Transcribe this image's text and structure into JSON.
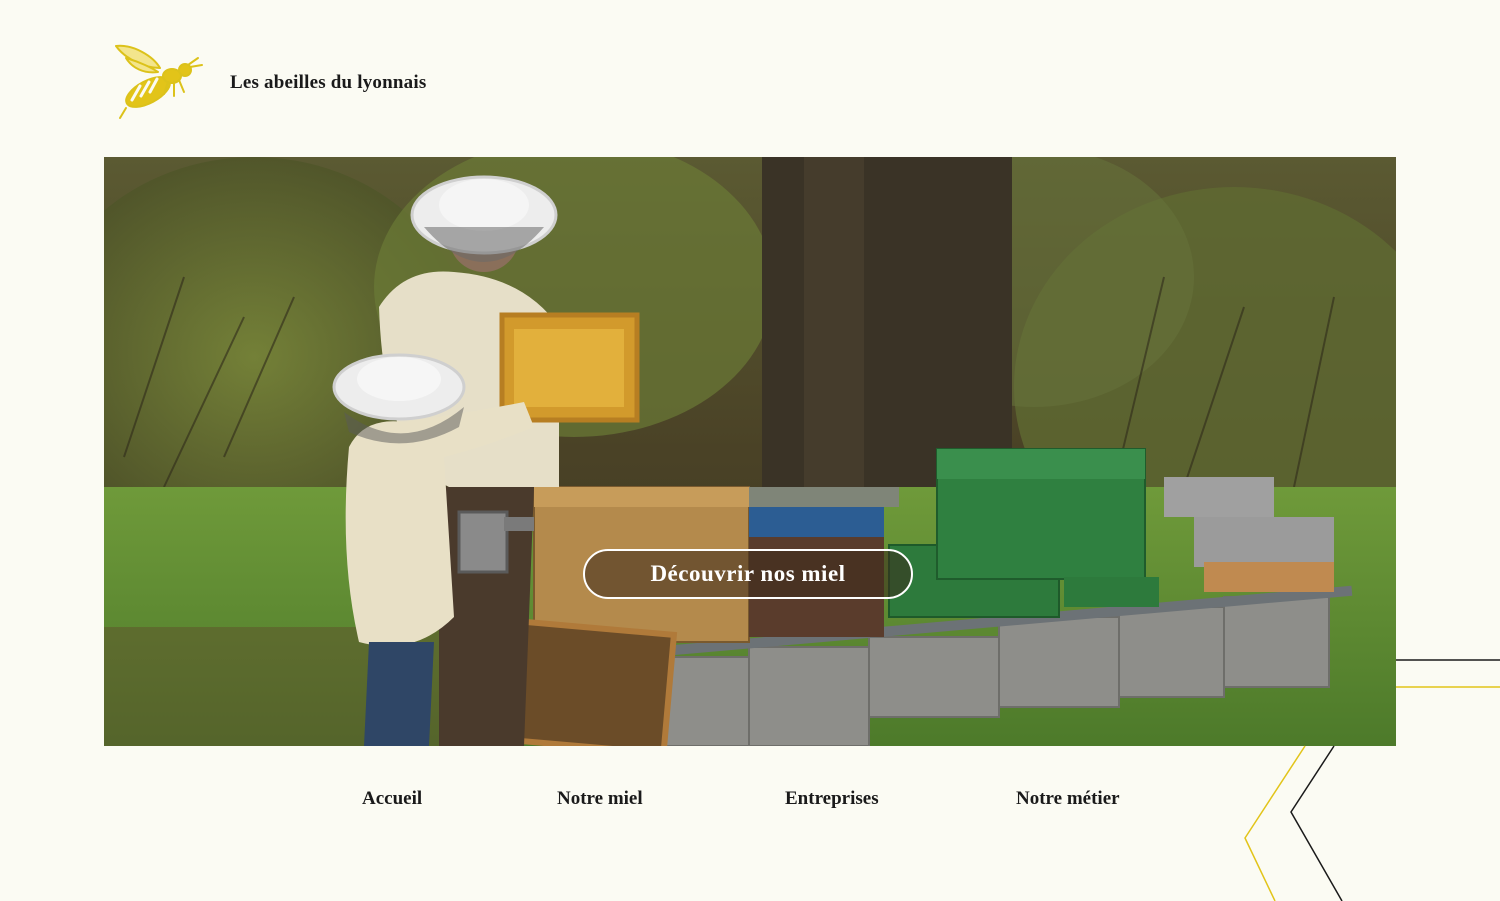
{
  "brand": {
    "name": "Les abeilles du lyonnais",
    "logo_icon": "bee-icon",
    "logo_color": "#dcc21a"
  },
  "hero": {
    "cta_label": "Découvrir nos miel"
  },
  "nav": {
    "items": [
      {
        "label": "Accueil"
      },
      {
        "label": "Notre miel"
      },
      {
        "label": "Entreprises"
      },
      {
        "label": "Notre métier"
      }
    ]
  },
  "colors": {
    "background": "#fbfbf3",
    "accent_yellow": "#e2c419",
    "text": "#1a1a1a"
  }
}
